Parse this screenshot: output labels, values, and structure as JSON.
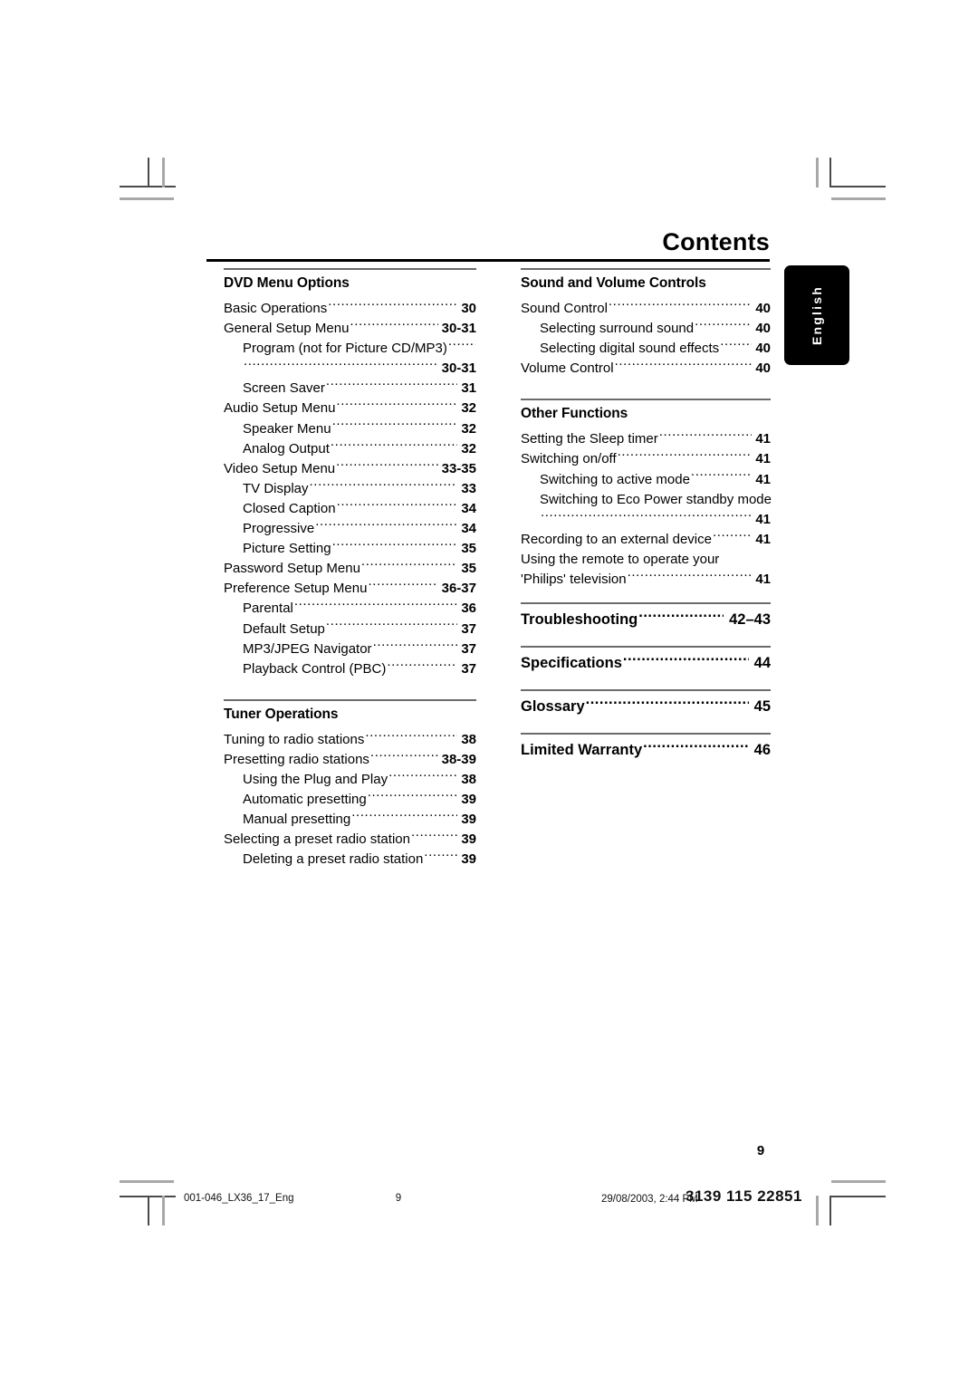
{
  "page": {
    "title": "Contents",
    "folio": "9",
    "language_tab": "English"
  },
  "footer": {
    "filename": "001-046_LX36_17_Eng",
    "page_marker": "9",
    "timestamp": "29/08/2003, 2:44 PM",
    "part_number": "3139 115 22851"
  },
  "colors": {
    "text": "#000000",
    "rule_main": "#000000",
    "rule_section": "#6b6b6b",
    "tab_background": "#000000",
    "tab_text": "#ffffff",
    "crop_mark": "#4a4a4a",
    "crop_mark_gray": "#a8a8a8"
  },
  "columns": {
    "left": [
      {
        "heading": "DVD Menu Options",
        "entries": [
          {
            "label": "Basic Operations",
            "page": "30",
            "level": 1
          },
          {
            "label": "General Setup Menu",
            "page": "30-31",
            "level": 1
          },
          {
            "label": "Program (not for Picture CD/MP3)",
            "page": "",
            "level": 2
          },
          {
            "label": "",
            "page": "30-31",
            "level": 2,
            "continuation": true
          },
          {
            "label": "Screen Saver",
            "page": "31",
            "level": 2
          },
          {
            "label": "Audio Setup Menu",
            "page": "32",
            "level": 1
          },
          {
            "label": "Speaker Menu",
            "page": "32",
            "level": 2
          },
          {
            "label": "Analog Output",
            "page": "32",
            "level": 2
          },
          {
            "label": "Video Setup Menu",
            "page": "33-35",
            "level": 1
          },
          {
            "label": "TV Display",
            "page": "33",
            "level": 2
          },
          {
            "label": "Closed Caption",
            "page": "34",
            "level": 2
          },
          {
            "label": "Progressive",
            "page": "34",
            "level": 2
          },
          {
            "label": "Picture Setting",
            "page": "35",
            "level": 2
          },
          {
            "label": "Password Setup Menu",
            "page": "35",
            "level": 1
          },
          {
            "label": "Preference Setup Menu",
            "page": "36-37",
            "level": 1
          },
          {
            "label": "Parental",
            "page": "36",
            "level": 2
          },
          {
            "label": "Default Setup",
            "page": "37",
            "level": 2
          },
          {
            "label": "MP3/JPEG Navigator",
            "page": "37",
            "level": 2
          },
          {
            "label": "Playback Control (PBC)",
            "page": "37",
            "level": 2
          }
        ]
      },
      {
        "heading": "Tuner Operations",
        "entries": [
          {
            "label": "Tuning to radio stations",
            "page": "38",
            "level": 1
          },
          {
            "label": "Presetting radio stations",
            "page": "38-39",
            "level": 1
          },
          {
            "label": "Using the Plug and Play",
            "page": "38",
            "level": 2
          },
          {
            "label": "Automatic presetting",
            "page": "39",
            "level": 2
          },
          {
            "label": "Manual presetting",
            "page": "39",
            "level": 2
          },
          {
            "label": "Selecting a preset radio station",
            "page": "39",
            "level": 1
          },
          {
            "label": "Deleting a preset radio station",
            "page": "39",
            "level": 2
          }
        ]
      }
    ],
    "right": [
      {
        "heading": "Sound and Volume Controls",
        "entries": [
          {
            "label": "Sound Control",
            "page": "40",
            "level": 1
          },
          {
            "label": "Selecting surround sound",
            "page": "40",
            "level": 2
          },
          {
            "label": "Selecting digital sound effects",
            "page": "40",
            "level": 2
          },
          {
            "label": "Volume Control",
            "page": "40",
            "level": 1
          }
        ]
      },
      {
        "heading": "Other Functions",
        "entries": [
          {
            "label": "Setting the Sleep timer",
            "page": "41",
            "level": 1
          },
          {
            "label": "Switching on/off",
            "page": "41",
            "level": 1
          },
          {
            "label": "Switching to active mode",
            "page": "41",
            "level": 2
          },
          {
            "label": "Switching to Eco Power standby mode",
            "page": "",
            "level": 2,
            "nodots": true
          },
          {
            "label": "",
            "page": "41",
            "level": 2,
            "continuation": true
          },
          {
            "label": "Recording to an external device",
            "page": "41",
            "level": 1
          },
          {
            "label": "Using the remote to operate your",
            "page": "",
            "level": 1,
            "nodots": true
          },
          {
            "label": "'Philips' television",
            "page": "41",
            "level": 1
          }
        ]
      }
    ],
    "right_big": [
      {
        "label": "Troubleshooting",
        "page": "42–43"
      },
      {
        "label": "Specifications",
        "page": "44"
      },
      {
        "label": "Glossary",
        "page": "45"
      },
      {
        "label": "Limited Warranty",
        "page": "46"
      }
    ]
  }
}
